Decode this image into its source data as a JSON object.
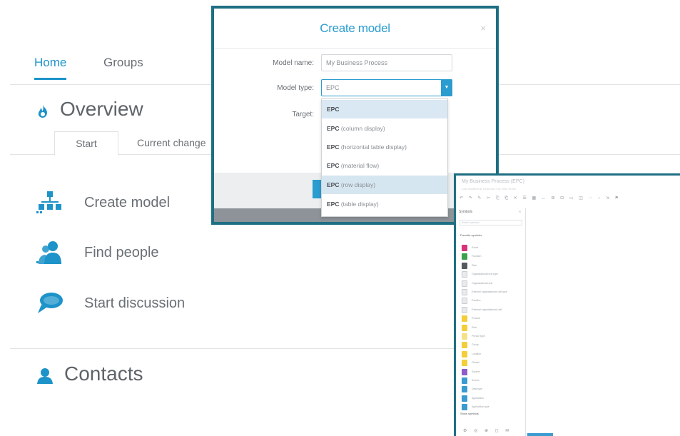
{
  "nav": {
    "tabs": [
      {
        "label": "Home",
        "active": true
      },
      {
        "label": "Groups",
        "active": false
      }
    ]
  },
  "overview": {
    "title": "Overview",
    "icon": "flame-icon",
    "subtabs": [
      {
        "label": "Start",
        "active": true
      },
      {
        "label": "Current change",
        "active": false
      }
    ],
    "actions": [
      {
        "label": "Create model",
        "icon": "create-model-icon"
      },
      {
        "label": "Find people",
        "icon": "find-people-icon"
      },
      {
        "label": "Start discussion",
        "icon": "chat-bubble-icon"
      }
    ]
  },
  "contacts": {
    "title": "Contacts",
    "icon": "person-icon"
  },
  "dialog": {
    "title": "Create model",
    "close_glyph": "×",
    "fields": {
      "model_name_label": "Model name:",
      "model_name_value": "My Business Process",
      "model_type_label": "Model type:",
      "model_type_value": "EPC",
      "target_label": "Target:"
    },
    "dropdown_options": [
      {
        "bold": "EPC",
        "rest": "",
        "selected": true
      },
      {
        "bold": "EPC",
        "rest": " (column display)"
      },
      {
        "bold": "EPC",
        "rest": " (horizontal table display)"
      },
      {
        "bold": "EPC",
        "rest": " (material flow)"
      },
      {
        "bold": "EPC",
        "rest": " (row display)",
        "hovered": true
      },
      {
        "bold": "EPC",
        "rest": " (table display)"
      }
    ]
  },
  "editor": {
    "title": "My Business Process (EPC)",
    "subtitle": "Last modified at 10/05/2017 by John Smith",
    "toolbar_glyphs": "↶ ↷ ✎ ✂ ⎘ ⎗ ✕ ☰ ▦ ↔ ⊞ ⊟ ▭ ◫ ⋯ ↕ ⇲ ⚑ ☷ ⌗ ⊡",
    "panel_title": "Symbols",
    "panel_collapse": "«",
    "search_placeholder": "Search symbols",
    "group_label": "Favorite symbols",
    "symbols": [
      {
        "label": "Event",
        "color": "#d6337a"
      },
      {
        "label": "Function",
        "color": "#3aa24c"
      },
      {
        "label": "Rule",
        "color": "#555a60"
      },
      {
        "label": "Organizational unit type",
        "color": "#e8eaeb"
      },
      {
        "label": "Organizational unit",
        "color": "#e8eaeb"
      },
      {
        "label": "External organizational unit type",
        "color": "#e8eaeb"
      },
      {
        "label": "Position",
        "color": "#e8eaeb"
      },
      {
        "label": "External organizational unit",
        "color": "#e8eaeb"
      },
      {
        "label": "Product",
        "color": "#f2cf3a"
      },
      {
        "label": "Role",
        "color": "#f2cf3a"
      },
      {
        "label": "Person type",
        "color": "#f5e08a"
      },
      {
        "label": "Group",
        "color": "#f2cf3a"
      },
      {
        "label": "Location",
        "color": "#f2cf3a"
      },
      {
        "label": "Cluster",
        "color": "#f2cf3a"
      },
      {
        "label": "System",
        "color": "#8e5bc9"
      },
      {
        "label": "Screen",
        "color": "#3a9bd0"
      },
      {
        "label": "Data type",
        "color": "#3a9bd0"
      },
      {
        "label": "Application",
        "color": "#3a9bd0"
      },
      {
        "label": "Application type",
        "color": "#3a9bd0"
      }
    ],
    "panel_footer": "Show symbols",
    "bottom_icons": "⚙ ◎ ⊕ ◻ ✉"
  }
}
